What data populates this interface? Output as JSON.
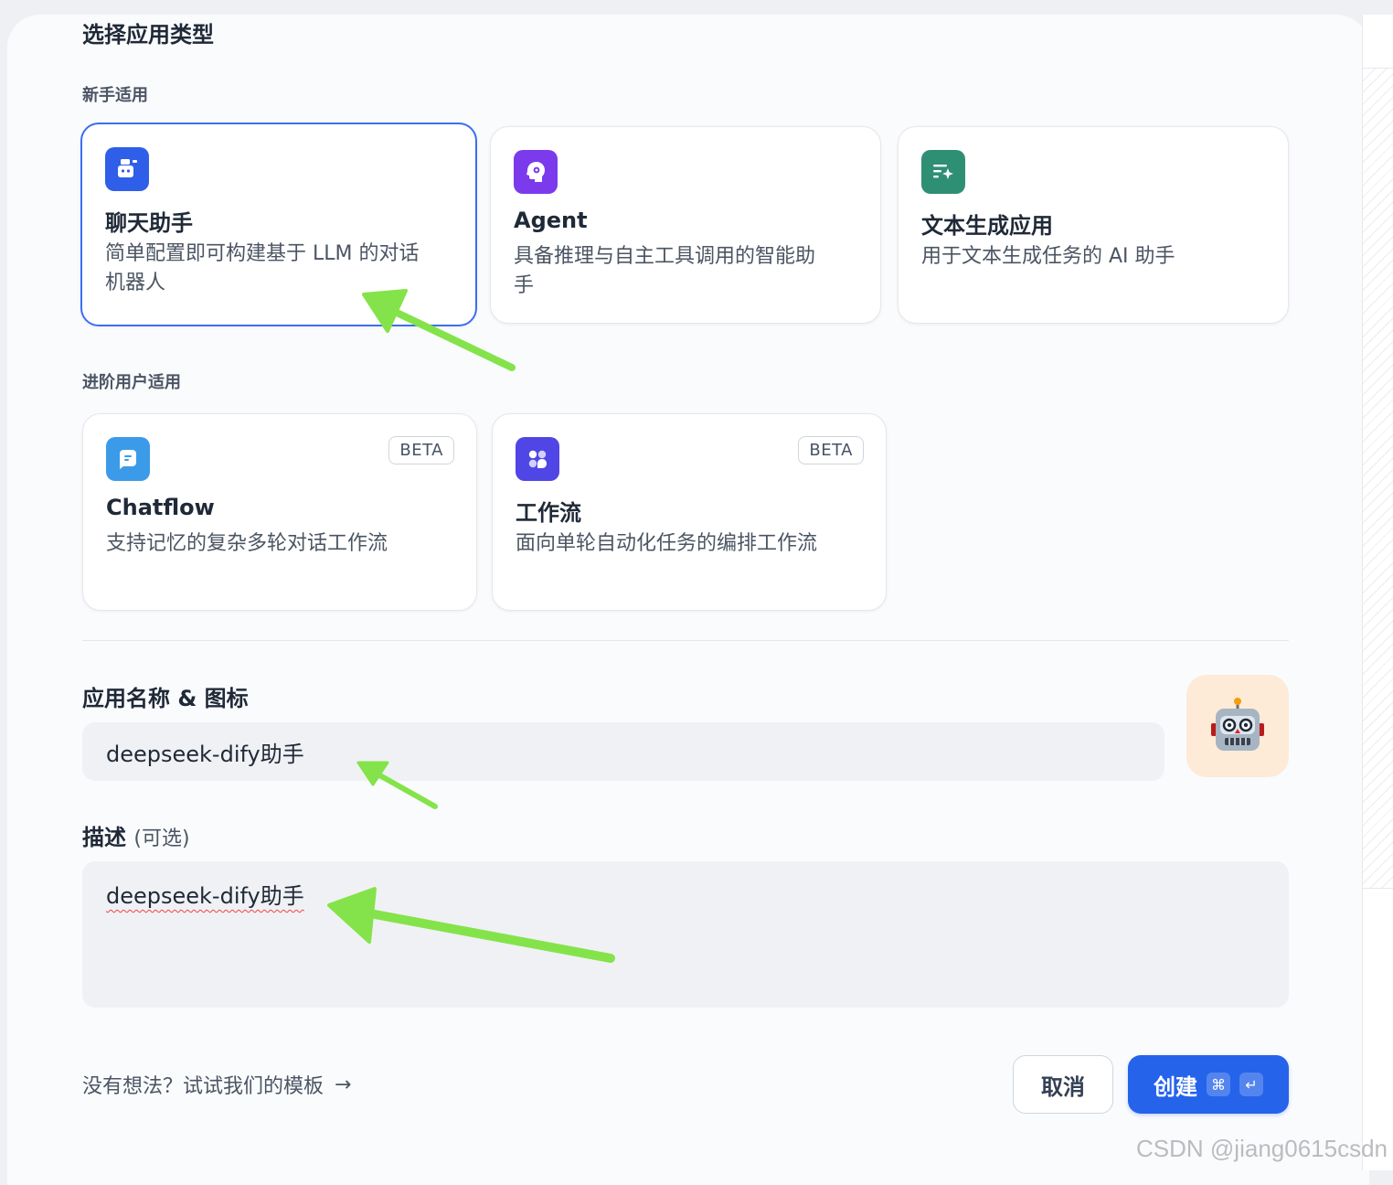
{
  "dialog": {
    "title": "选择应用类型",
    "beginner_section": "新手适用",
    "advanced_section": "进阶用户适用"
  },
  "app_types": {
    "chat": {
      "title": "聊天助手",
      "desc_line1": "简单配置即可构建基于 LLM 的对话",
      "desc_line2": "机器人",
      "icon": "chat-bot-icon",
      "color": "#2f5fe8",
      "selected": true
    },
    "agent": {
      "title": "Agent",
      "desc_line1": "具备推理与自主工具调用的智能助",
      "desc_line2": "手",
      "icon": "agent-brain-icon",
      "color": "#7c3aed"
    },
    "textgen": {
      "title": "文本生成应用",
      "desc_line1": "用于文本生成任务的 AI 助手",
      "icon": "text-sparkle-icon",
      "color": "#2f8f74"
    },
    "chatflow": {
      "title": "Chatflow",
      "desc_line1": "支持记忆的复杂多轮对话工作流",
      "badge": "BETA",
      "icon": "chatflow-icon",
      "color": "#3b9be8"
    },
    "workflow": {
      "title": "工作流",
      "desc_line1": "面向单轮自动化任务的编排工作流",
      "badge": "BETA",
      "icon": "workflow-icon",
      "color": "#5046e5"
    }
  },
  "form": {
    "name_label": "应用名称 & 图标",
    "name_value": "deepseek-dify助手",
    "app_icon": "🤖",
    "desc_label": "描述",
    "desc_optional": "(可选)",
    "desc_value": "deepseek-dify助手"
  },
  "footer": {
    "template_link": "没有想法？试试我们的模板",
    "template_arrow": "→",
    "cancel": "取消",
    "create": "创建",
    "shortcut_cmd": "⌘",
    "shortcut_enter": "↵"
  },
  "watermark": "CSDN @jiang0615csdn"
}
